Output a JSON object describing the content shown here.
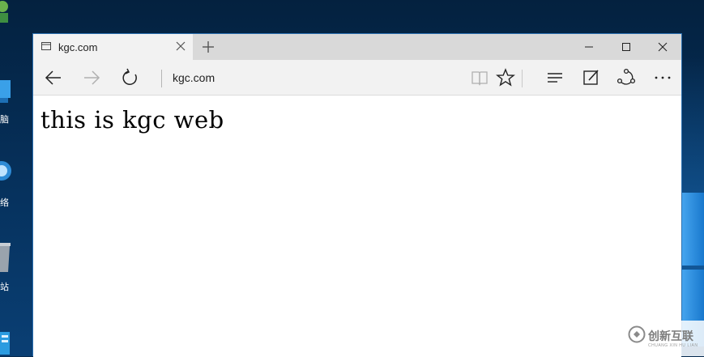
{
  "desktop": {
    "icons": [
      {
        "label": "脑",
        "icon": "computer-icon"
      },
      {
        "label": "络",
        "icon": "network-icon"
      },
      {
        "label": "站",
        "icon": "recycle-bin-icon"
      },
      {
        "label": "",
        "icon": "app-icon"
      }
    ]
  },
  "browser": {
    "tab": {
      "title": "kgc.com",
      "favicon": "page-icon",
      "close_icon": "close-icon"
    },
    "new_tab_icon": "plus-icon",
    "window_controls": [
      "minimize-icon",
      "maximize-icon",
      "close-icon"
    ],
    "nav": {
      "back_icon": "back-arrow-icon",
      "forward_icon": "forward-arrow-icon",
      "refresh_icon": "refresh-icon",
      "address": "kgc.com",
      "reading_view_icon": "book-icon",
      "favorite_icon": "star-icon",
      "hub_icon": "hub-icon",
      "note_icon": "web-note-icon",
      "share_icon": "share-icon",
      "more_icon": "more-icon"
    },
    "page": {
      "text": "this is kgc web"
    }
  },
  "watermark": {
    "text": "创新互联",
    "subtext": "CHUANG XIN HU LIAN"
  },
  "colors": {
    "desktop": "#06325e",
    "window_border": "#2a6fb0",
    "chrome": "#f2f2f2",
    "titlebar": "#d9d9d9"
  }
}
